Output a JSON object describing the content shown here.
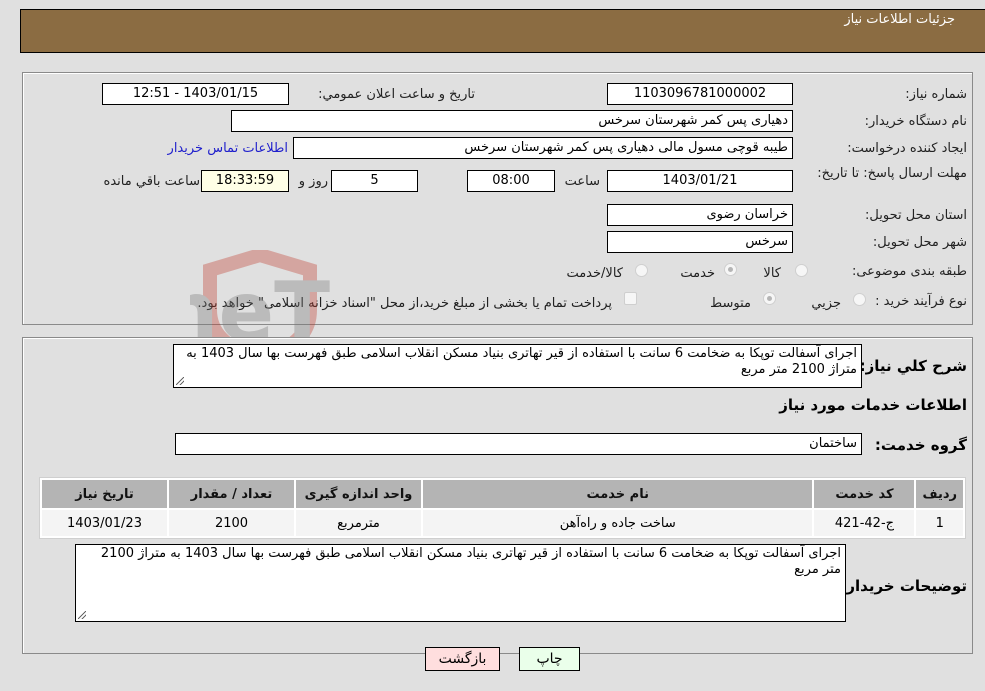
{
  "header": {
    "title": "جزئیات اطلاعات نیاز"
  },
  "details": {
    "need_number_label": "شماره نیاز:",
    "need_number": "1103096781000002",
    "announce_label": "تاريخ و ساعت اعلان عمومي:",
    "announce_value": "1403/01/15 - 12:51",
    "buyer_org_label": "نام دستگاه خريدار:",
    "buyer_org": "دهیاری پس کمر شهرستان سرخس",
    "requester_label": "ايجاد کننده درخواست:",
    "requester": "طیبه قوچی مسول مالی دهیاری پس کمر شهرستان سرخس",
    "contact_link": "اطلاعات تماس خريدار",
    "deadline_label": "مهلت ارسال پاسخ: تا تاريخ:",
    "deadline_date": "1403/01/21",
    "time_label": "ساعت",
    "deadline_time": "08:00",
    "days_value": "5",
    "days_label": "روز و",
    "remaining_time": "18:33:59",
    "remaining_label": "ساعت باقي مانده",
    "province_label": "استان محل تحویل:",
    "province": "خراسان رضوی",
    "city_label": "شهر محل تحویل:",
    "city": "سرخس",
    "category_label": "طبقه بندی موضوعی:",
    "category_options": [
      {
        "label": "کالا",
        "checked": false
      },
      {
        "label": "خدمت",
        "checked": true
      },
      {
        "label": "کالا/خدمت",
        "checked": false
      }
    ],
    "process_label": "نوع فرآيند خريد :",
    "process_options": [
      {
        "label": "جزيي",
        "checked": false
      },
      {
        "label": "متوسط",
        "checked": true
      }
    ],
    "treasury_note": "پرداخت تمام یا بخشی از مبلغ خرید،از محل \"اسناد خزانه اسلامی\" خواهد بود."
  },
  "services": {
    "description_label": "شرح كلي نياز:",
    "description": "اجرای آسفالت توپکا به ضخامت 6 سانت با استفاده از قیر تهاتری بنیاد مسکن انقلاب اسلامی طبق فهرست بها سال 1403 به متراژ 2100 متر مربع",
    "section_title": "اطلاعات خدمات مورد نياز",
    "group_label": "گروه خدمت:",
    "group_value": "ساختمان",
    "table": {
      "headers": [
        "رديف",
        "کد خدمت",
        "نام خدمت",
        "واحد اندازه گیری",
        "تعداد / مقدار",
        "تاریخ نیاز"
      ],
      "rows": [
        [
          "1",
          "ج-42-421",
          "ساخت جاده و راه‌آهن",
          "مترمربع",
          "2100",
          "1403/01/23"
        ]
      ]
    },
    "buyer_notes_label": "توضيحات خريدار:",
    "buyer_notes": "اجرای آسفالت توپکا به ضخامت 6 سانت با استفاده از قیر تهاتری بنیاد مسکن انقلاب اسلامی طبق فهرست بها سال 1403 به متراژ 2100 متر مربع"
  },
  "buttons": {
    "print": "چاپ",
    "back": "بازگشت"
  },
  "watermark": {
    "text": "AriaTender.neT"
  }
}
